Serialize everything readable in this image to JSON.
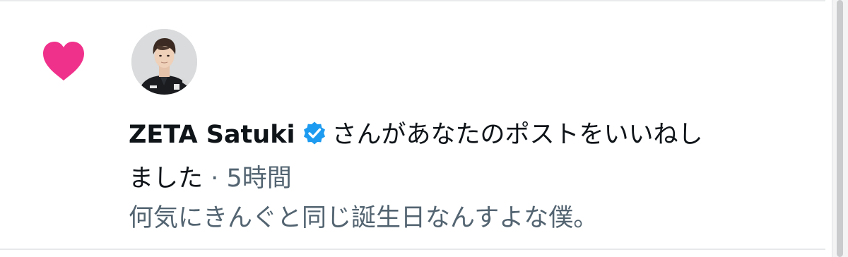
{
  "notification": {
    "type_icon": "heart-icon",
    "actor": {
      "name": "ZETA Satuki",
      "verified_icon": "verified-badge-icon",
      "avatar": "avatar"
    },
    "action_line1": "さんがあなたのポストをいいねし",
    "action_line2": "ました",
    "separator": "·",
    "time": "5時間",
    "post_preview": "何気にきんぐと同じ誕生日なんすよな僕。"
  },
  "colors": {
    "heart": "#f0318b",
    "verified": "#1d9bf0",
    "primary_text": "#0f1419",
    "secondary_text": "#536471",
    "divider": "#e6e8ea"
  }
}
